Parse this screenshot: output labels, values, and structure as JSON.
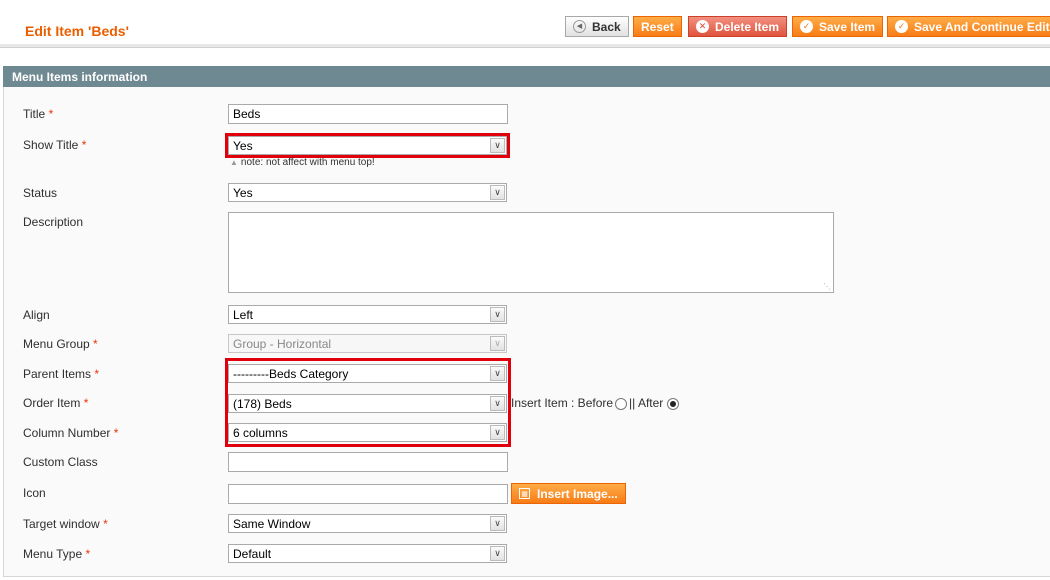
{
  "header": {
    "title": "Edit Item 'Beds'",
    "buttons": {
      "back": "Back",
      "reset": "Reset",
      "delete": "Delete Item",
      "save": "Save Item",
      "save_continue": "Save And Continue Edit"
    }
  },
  "fieldset": {
    "legend": "Menu Items information"
  },
  "form": {
    "title": {
      "label": "Title",
      "value": "Beds"
    },
    "show_title": {
      "label": "Show Title",
      "value": "Yes",
      "note": "note: not affect with menu top!"
    },
    "status": {
      "label": "Status",
      "value": "Yes"
    },
    "description": {
      "label": "Description",
      "value": ""
    },
    "align": {
      "label": "Align",
      "value": "Left"
    },
    "menu_group": {
      "label": "Menu Group",
      "value": "Group - Horizontal"
    },
    "parent_items": {
      "label": "Parent Items",
      "value": "---------Beds Category"
    },
    "order_item": {
      "label": "Order Item",
      "value": "(178) Beds",
      "insert_label": "Insert Item : Before",
      "after_label": "|| After",
      "selected": "After"
    },
    "column_number": {
      "label": "Column Number",
      "value": "6 columns"
    },
    "custom_class": {
      "label": "Custom Class",
      "value": ""
    },
    "icon": {
      "label": "Icon",
      "value": "",
      "button": "Insert Image..."
    },
    "target_window": {
      "label": "Target window",
      "value": "Same Window"
    },
    "menu_type": {
      "label": "Menu Type",
      "value": "Default"
    }
  },
  "required_mark": "*",
  "colors": {
    "accent": "#eb5e00",
    "header_bar": "#6f8992",
    "highlight": "#e0000b"
  }
}
